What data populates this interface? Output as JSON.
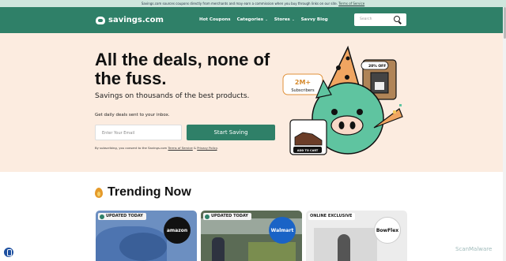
{
  "disclosure": {
    "text": "Savings.com sources coupons directly from merchants and may earn a commission when you buy through links on our site.",
    "link": "Terms of Service"
  },
  "header": {
    "logo_text": "savings.com",
    "nav": [
      "Hot Coupons",
      "Categories",
      "Stores",
      "Savvy Blog"
    ],
    "search_placeholder": "Search"
  },
  "hero": {
    "title": "All the deals, none of the fuss.",
    "subtitle": "Savings on thousands of the best products.",
    "daily_label": "Get daily deals sent to your inbox.",
    "email_placeholder": "Enter Your Email",
    "cta": "Start Saving",
    "consent_prefix": "By subscribing, you consent to the Savings.com",
    "consent_tos": "Terms of Service",
    "consent_and": "&",
    "consent_privacy": "Privacy Policy",
    "consent_end": "."
  },
  "illustration": {
    "stat_value": "2M+",
    "stat_label": "Subscribers",
    "discount_badge": "20% OFF",
    "add_to_cart": "ADD TO CART"
  },
  "trending": {
    "title": "Trending Now",
    "cards": [
      {
        "badge": "UPDATED TODAY",
        "brand": "amazon"
      },
      {
        "badge": "UPDATED TODAY",
        "brand": "Walmart"
      },
      {
        "badge": "ONLINE EXCLUSIVE",
        "brand": "BowFlex"
      }
    ]
  },
  "watermark": "ScanMalware",
  "colors": {
    "brand_green": "#2f8068",
    "hero_bg": "#fcece0",
    "pig_green": "#5fc4a0"
  }
}
